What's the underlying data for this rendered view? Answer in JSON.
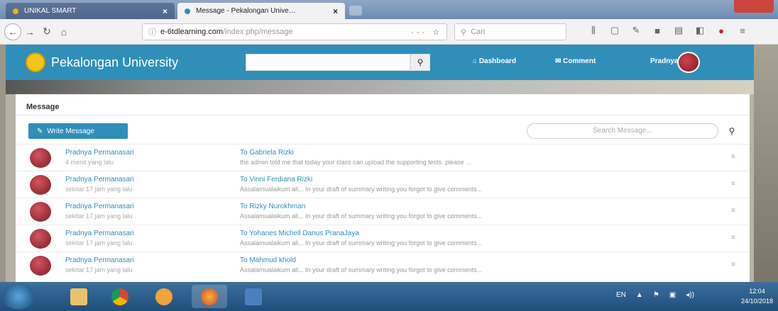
{
  "browser": {
    "tabs": [
      {
        "title": "UNIKAL SMART",
        "active": false
      },
      {
        "title": "Message - Pekalongan Unive…",
        "active": true
      }
    ],
    "url_host": "e-6tdlearning.com",
    "url_path": "/index.php/message",
    "url_tools": "··· ☆",
    "search_placeholder": "Cari"
  },
  "site": {
    "brand": "Pekalongan University",
    "nav": {
      "dashboard": "Dashboard",
      "comment": "Comment",
      "user": "Pradnya"
    }
  },
  "panel": {
    "title": "Message",
    "write_button": "Write Message",
    "search_placeholder": "Search Message..."
  },
  "messages": [
    {
      "sender": "Pradnya Permanasari",
      "time": "4 menit yang lalu",
      "to": "To Gabriela Rizki",
      "snippet": "the admin told me that today your class can upload the supporting tests. please ..."
    },
    {
      "sender": "Pradnya Permanasari",
      "time": "sekitar 17 jam yang lalu",
      "to": "To Vinni Ferdiana Rizki",
      "snippet": "Assalamualaikum all... In your draft of summary writing you forgot to give comments..."
    },
    {
      "sender": "Pradnya Permanasari",
      "time": "sekitar 17 jam yang lalu",
      "to": "To Rizky Nurokhman",
      "snippet": "Assalamualaikum all... In your draft of summary writing you forgot to give comments..."
    },
    {
      "sender": "Pradnya Permanasari",
      "time": "sekitar 17 jam yang lalu",
      "to": "To Yohanes Michell Danus PranaJaya",
      "snippet": "Assalamualaikum all... In your draft of summary writing you forgot to give comments..."
    },
    {
      "sender": "Pradnya Permanasari",
      "time": "sekitar 17 jam yang lalu",
      "to": "To Mahmud khold",
      "snippet": "Assalamualaikum all... In your draft of summary writing you forgot to give comments..."
    }
  ],
  "taskbar": {
    "lang": "EN",
    "time": "12:04",
    "date": "24/10/2018"
  }
}
